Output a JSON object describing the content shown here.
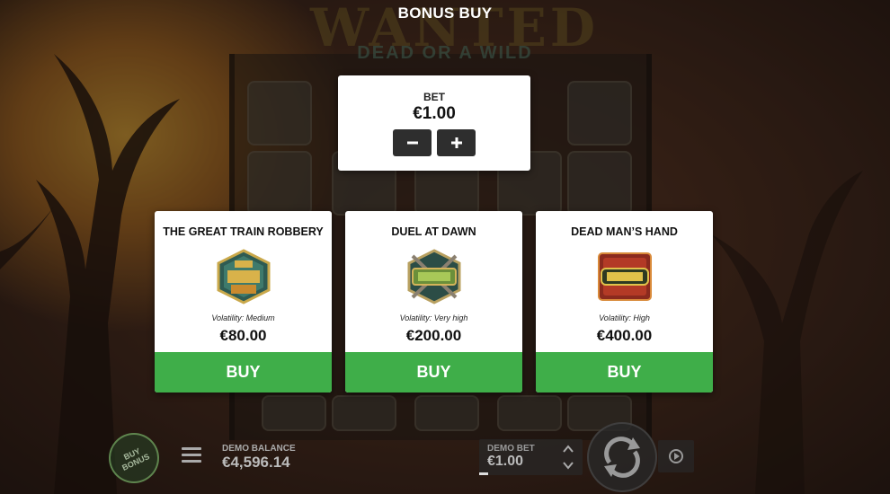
{
  "game": {
    "logo": "WANTED",
    "logo_sub": "DEAD OR A WILD"
  },
  "modal": {
    "title": "BONUS BUY",
    "bet": {
      "label": "BET",
      "value": "€1.00",
      "decrease_label": "−",
      "increase_label": "+"
    },
    "options": [
      {
        "title": "THE GREAT TRAIN ROBBERY",
        "badge_icon": "great-train-robbery-badge-icon",
        "volatility": "Volatility: Medium",
        "price": "€80.00",
        "buy_label": "BUY"
      },
      {
        "title": "DUEL AT DAWN",
        "badge_icon": "duel-badge-icon",
        "volatility": "Volatility: Very high",
        "price": "€200.00",
        "buy_label": "BUY"
      },
      {
        "title": "DEAD MAN’S HAND",
        "badge_icon": "dead-badge-icon",
        "volatility": "Volatility: High",
        "price": "€400.00",
        "buy_label": "BUY"
      }
    ]
  },
  "bottom_bar": {
    "buy_bonus_label": "BUY BONUS",
    "balance_label": "DEMO BALANCE",
    "balance_value": "€4,596.14",
    "bet_label": "DEMO BET",
    "bet_value": "€1.00"
  },
  "colors": {
    "buy_green": "#3fae49",
    "card_bg": "#ffffff",
    "bet_button": "#2e2e2e"
  }
}
